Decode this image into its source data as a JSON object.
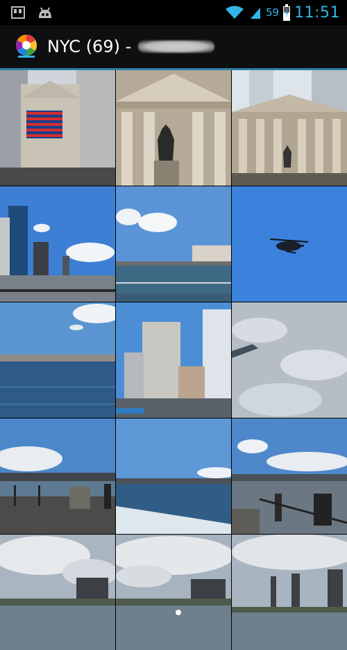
{
  "status_bar": {
    "left_icons": [
      "sd-card-icon",
      "android-icon"
    ],
    "battery_percent": "59",
    "time": "11:51"
  },
  "action_bar": {
    "app_icon": "picasa-icon",
    "title": "NYC (69) -"
  },
  "accent_color": "#2e7fa7",
  "photos": [
    {
      "subject": "stock exchange with flag"
    },
    {
      "subject": "federal hall statue"
    },
    {
      "subject": "federal hall columns"
    },
    {
      "subject": "skyline blue sky"
    },
    {
      "subject": "harbor with clouds"
    },
    {
      "subject": "helicopter in sky"
    },
    {
      "subject": "harbor water"
    },
    {
      "subject": "skyscrapers downtown"
    },
    {
      "subject": "boat wake water"
    },
    {
      "subject": "pier with bridge"
    },
    {
      "subject": "water with skyline"
    },
    {
      "subject": "pier railing with bridge"
    },
    {
      "subject": "skyline cloudy"
    },
    {
      "subject": "skyline cloudy 2"
    },
    {
      "subject": "skyline cloudy 3"
    }
  ]
}
